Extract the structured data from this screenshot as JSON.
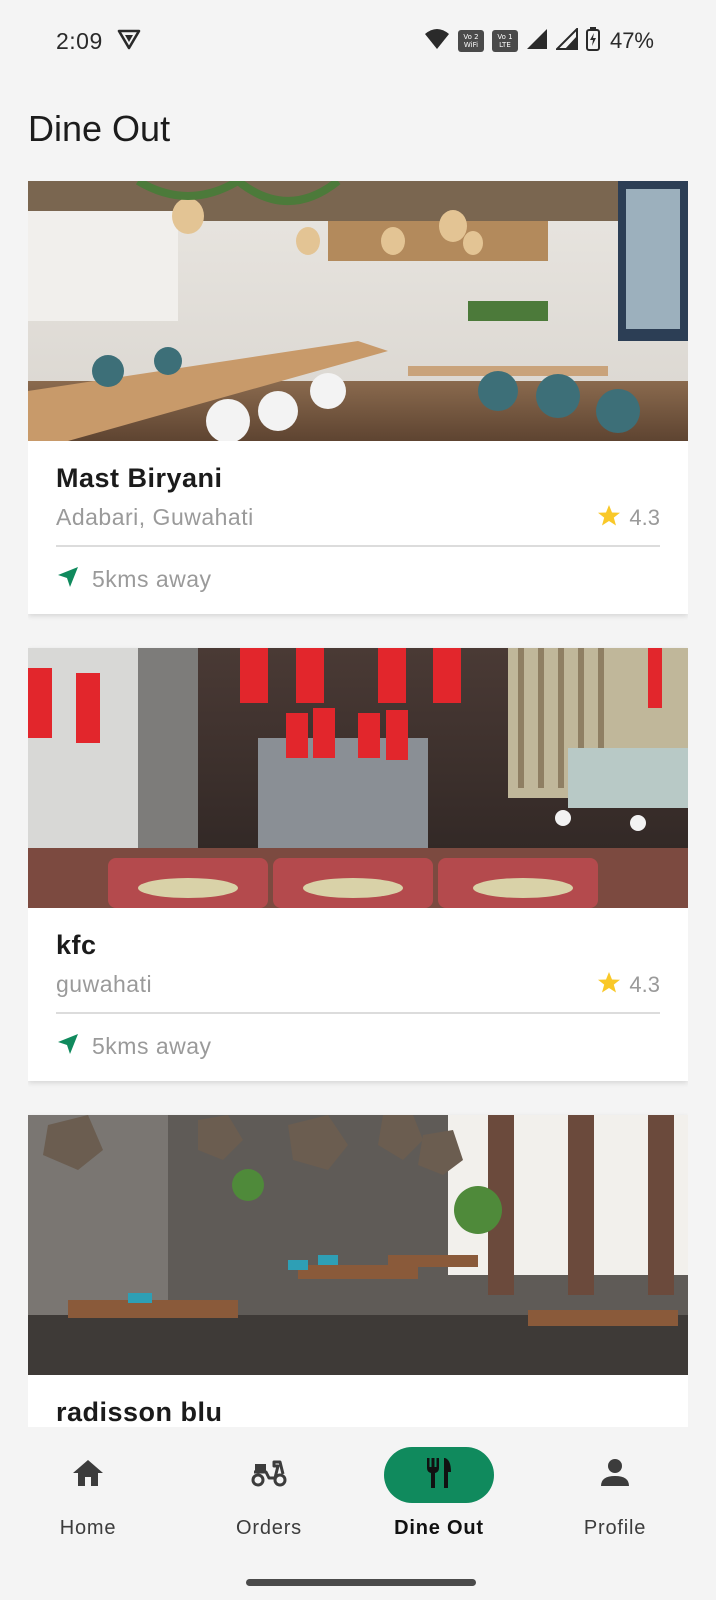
{
  "status_bar": {
    "time": "2:09",
    "battery": "47%",
    "badge_1": [
      "Vo 2",
      "WiFi"
    ],
    "badge_2": [
      "Vo 1",
      "LTE"
    ],
    "icons": [
      "vpn-icon",
      "wifi-icon",
      "signal-icon",
      "battery-icon"
    ]
  },
  "page": {
    "title": "Dine Out"
  },
  "restaurants": [
    {
      "name": "Mast Biryani",
      "location": "Adabari, Guwahati",
      "rating": "4.3",
      "distance": "5kms away",
      "image": "restaurant-interior-wood-tables-teal-chairs"
    },
    {
      "name": "kfc",
      "location": "guwahati",
      "rating": "4.3",
      "distance": "5kms away",
      "image": "restaurant-interior-red-lanterns-booths"
    },
    {
      "name": "radisson blu",
      "location": "",
      "rating": "",
      "distance": "",
      "image": "restaurant-interior-geometric-pendants"
    }
  ],
  "bottom_nav": {
    "items": [
      {
        "label": "Home",
        "icon": "home-icon",
        "active": false
      },
      {
        "label": "Orders",
        "icon": "scooter-icon",
        "active": false
      },
      {
        "label": "Dine Out",
        "icon": "fork-knife-icon",
        "active": true
      },
      {
        "label": "Profile",
        "icon": "person-icon",
        "active": false
      }
    ]
  },
  "colors": {
    "accent": "#108a5d",
    "star": "#f9c828",
    "background": "#f4f4f4",
    "muted_text": "#9a9a9a"
  }
}
